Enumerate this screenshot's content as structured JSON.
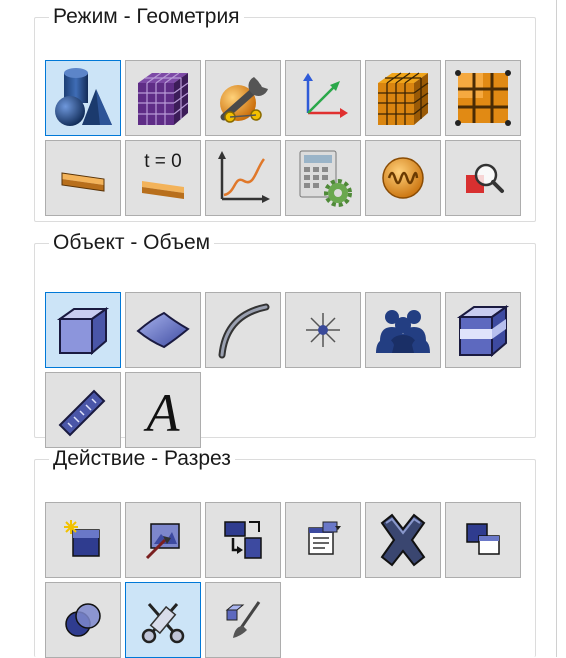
{
  "groups": [
    {
      "title": "Режим - Геометрия",
      "buttons": [
        {
          "icon": "shapes-icon",
          "active": true
        },
        {
          "icon": "purple-mesh-cube-icon",
          "active": false
        },
        {
          "icon": "wrench-sphere-icon",
          "active": false
        },
        {
          "icon": "coordinate-axes-icon",
          "active": false
        },
        {
          "icon": "orange-mesh-cube-icon",
          "active": false
        },
        {
          "icon": "grid-plane-icon",
          "active": false
        },
        {
          "icon": "strip-icon",
          "active": false
        },
        {
          "icon": "time-zero-strip-icon",
          "active": false,
          "label": "t = 0"
        },
        {
          "icon": "line-graph-icon",
          "active": false
        },
        {
          "icon": "calculator-gear-icon",
          "active": false
        },
        {
          "icon": "oscillation-icon",
          "active": false
        },
        {
          "icon": "magnifier-icon",
          "active": false
        }
      ]
    },
    {
      "title": "Объект - Объем",
      "buttons": [
        {
          "icon": "box-icon",
          "active": true
        },
        {
          "icon": "surface-icon",
          "active": false
        },
        {
          "icon": "curve-icon",
          "active": false
        },
        {
          "icon": "point-icon",
          "active": false
        },
        {
          "icon": "group-icon",
          "active": false
        },
        {
          "icon": "layered-box-icon",
          "active": false
        },
        {
          "icon": "ruler-icon",
          "active": false
        },
        {
          "icon": "text-icon",
          "active": false,
          "label": "A"
        }
      ]
    },
    {
      "title": "Действие - Разрез",
      "buttons": [
        {
          "icon": "new-object-icon",
          "active": false
        },
        {
          "icon": "edit-image-icon",
          "active": false
        },
        {
          "icon": "transform-icon",
          "active": false
        },
        {
          "icon": "properties-icon",
          "active": false
        },
        {
          "icon": "delete-icon",
          "active": false
        },
        {
          "icon": "copy-icon",
          "active": false
        },
        {
          "icon": "boolean-icon",
          "active": false
        },
        {
          "icon": "cut-icon",
          "active": true
        },
        {
          "icon": "sweep-icon",
          "active": false
        }
      ]
    }
  ]
}
